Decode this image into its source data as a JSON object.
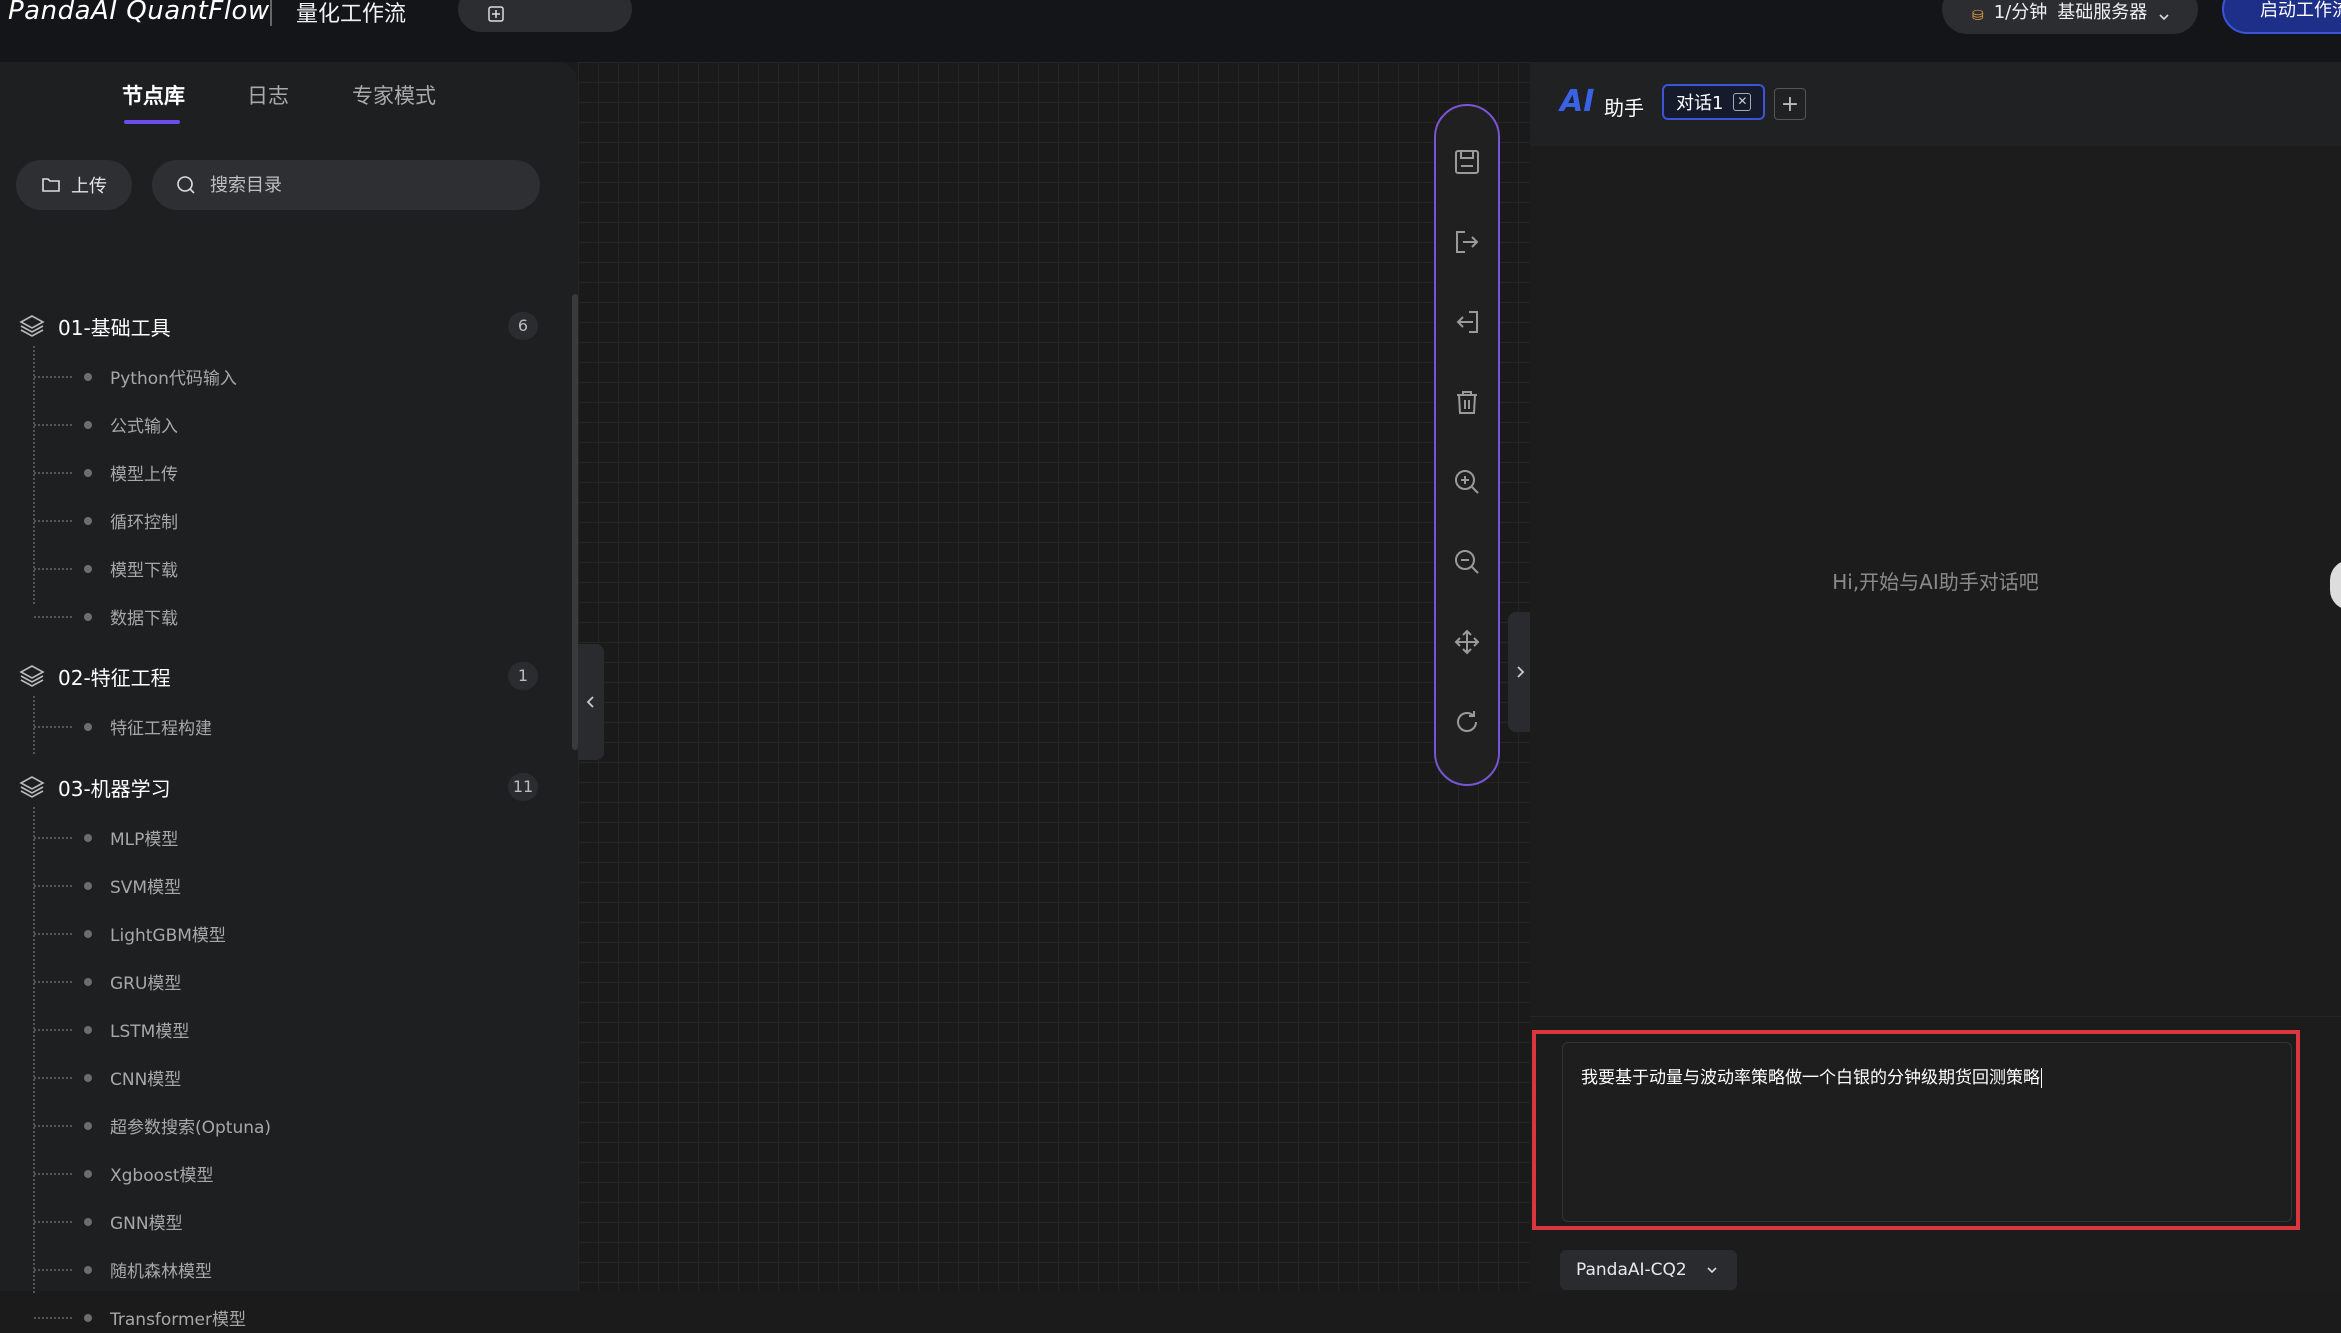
{
  "topbar": {
    "brand": "PandaAI QuantFlow",
    "subtitle": "量化工作流",
    "create_label": "创建工作流",
    "server_rate": "1/分钟",
    "server_name": "基础服务器",
    "start_label": "启动工作流"
  },
  "left": {
    "tabs": [
      "节点库",
      "日志",
      "专家模式"
    ],
    "active_tab": 0,
    "upload_label": "上传",
    "search_placeholder": "搜索目录",
    "categories": [
      {
        "label": "01-基础工具",
        "count": "6",
        "items": [
          "Python代码输入",
          "公式输入",
          "模型上传",
          "循环控制",
          "模型下载",
          "数据下载"
        ]
      },
      {
        "label": "02-特征工程",
        "count": "1",
        "items": [
          "特征工程构建"
        ]
      },
      {
        "label": "03-机器学习",
        "count": "11",
        "items": [
          "MLP模型",
          "SVM模型",
          "LightGBM模型",
          "GRU模型",
          "LSTM模型",
          "CNN模型",
          "超参数搜索(Optuna)",
          "Xgboost模型",
          "GNN模型",
          "随机森林模型",
          "Transformer模型"
        ]
      }
    ]
  },
  "toolbar": {
    "tools": [
      "save-icon",
      "export-icon",
      "import-icon",
      "delete-icon",
      "zoom-in-icon",
      "zoom-out-icon",
      "move-icon",
      "refresh-icon"
    ]
  },
  "ai": {
    "logo": "AI",
    "title": "助手",
    "chat_tab": "对话1",
    "add_symbol": "+",
    "empty_hint": "Hi,开始与AI助手对话吧",
    "input_value": "我要基于动量与波动率策略做一个白银的分钟级期货回测策略",
    "model": "PandaAI-CQ2"
  },
  "colors": {
    "accent_purple": "#6b4cf0",
    "accent_blue": "#3b55d6",
    "highlight_red": "#d9363e"
  }
}
